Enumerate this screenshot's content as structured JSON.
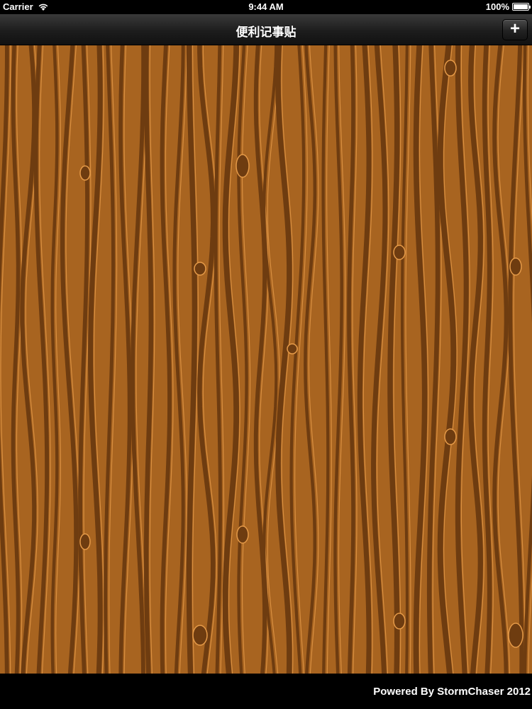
{
  "status_bar": {
    "carrier": "Carrier",
    "time": "9:44 AM",
    "battery": "100%",
    "battery_level": 1.0
  },
  "nav_bar": {
    "title": "便利记事贴",
    "add_label": "+"
  },
  "background": {
    "base_color": "#a86420",
    "grain_dark": "#6e3c10",
    "grain_light": "#e59a48"
  },
  "footer": {
    "text": "Powered By StormChaser 2012"
  }
}
